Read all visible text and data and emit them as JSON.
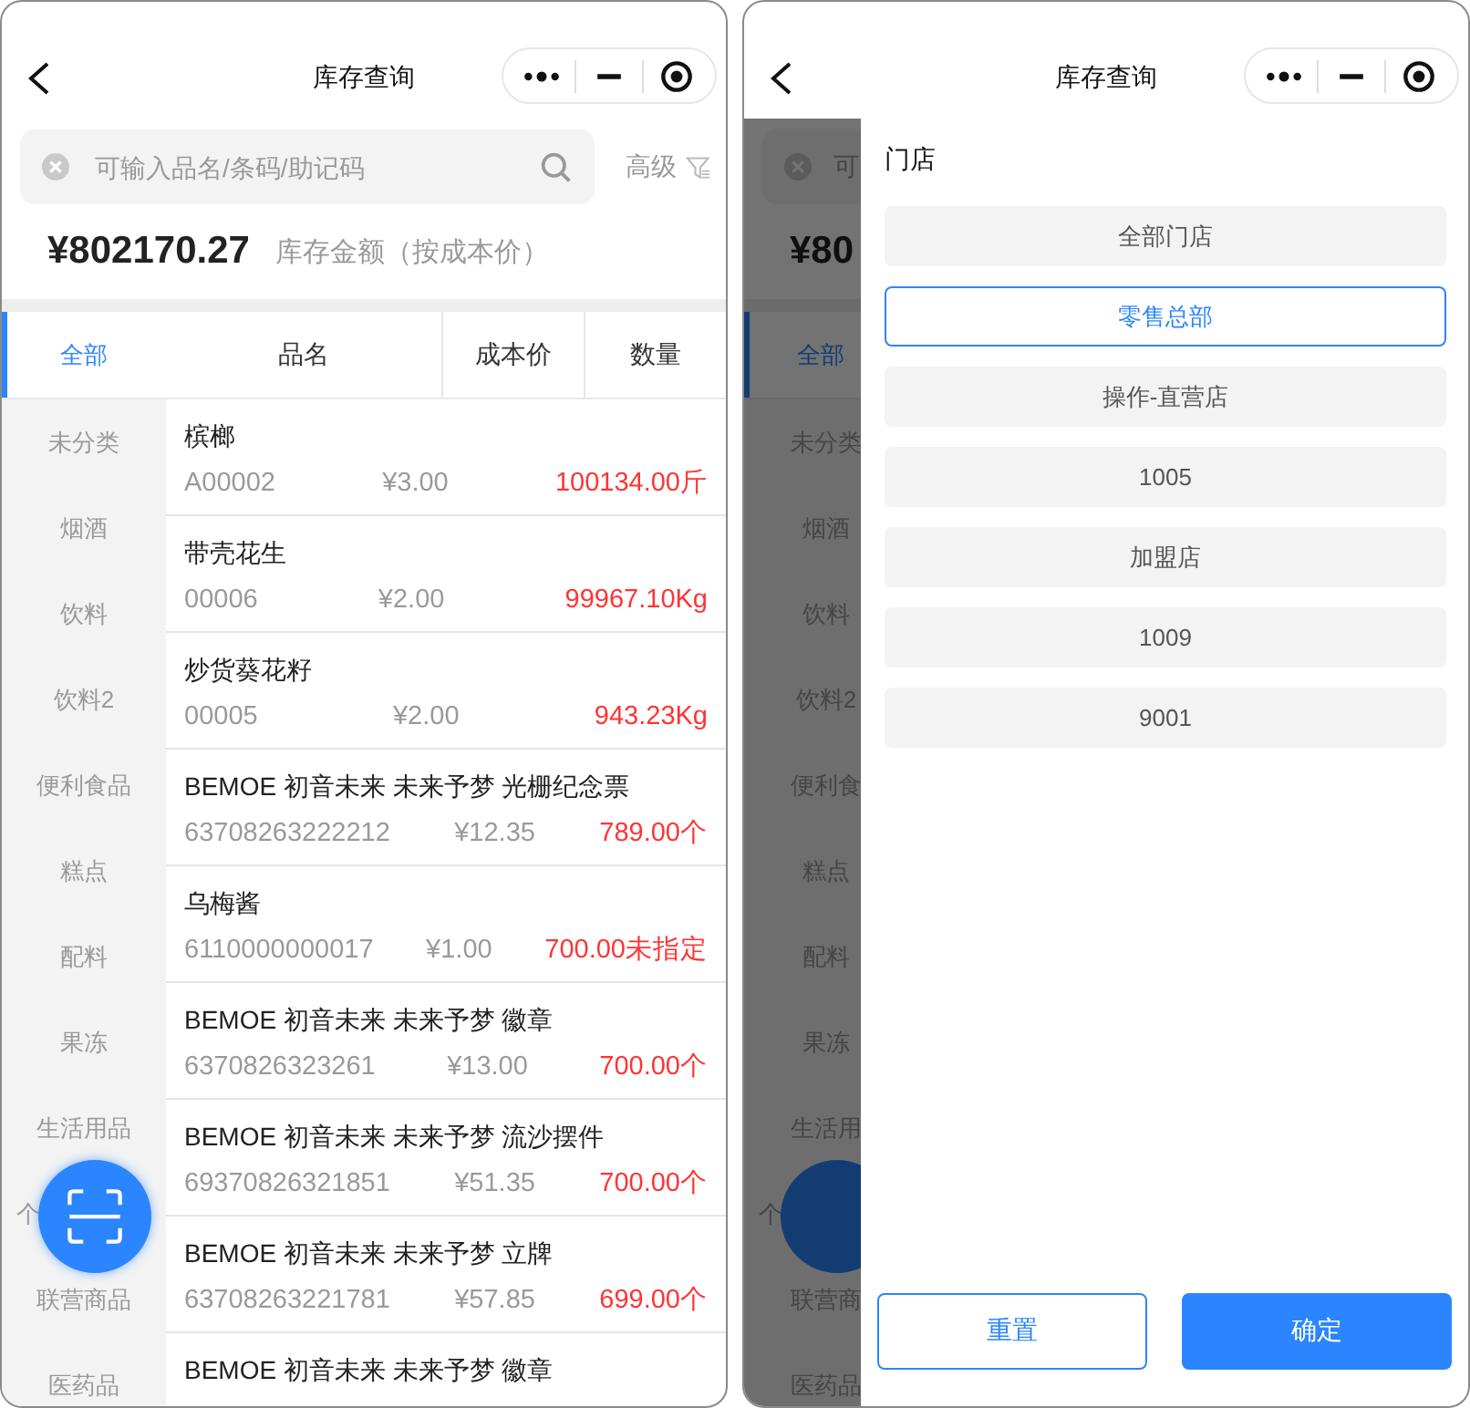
{
  "left_screen": {
    "nav": {
      "title": "库存查询"
    },
    "search": {
      "placeholder": "可输入品名/条码/助记码"
    },
    "advanced": "高级",
    "total": {
      "amount": "¥802170.27",
      "label": "库存金额（按成本价）"
    },
    "category_tab": {
      "label": "全部",
      "selected": true
    },
    "columns": [
      "品名",
      "成本价",
      "数量"
    ],
    "categories": [
      {
        "label": "未分类",
        "kind": "full"
      },
      {
        "label": "烟酒",
        "kind": "full"
      },
      {
        "label": "饮料",
        "kind": "full"
      },
      {
        "label": "饮料2",
        "kind": "full"
      },
      {
        "label": "便利食品",
        "kind": "full"
      },
      {
        "label": "糕点",
        "kind": "full"
      },
      {
        "label": "配料",
        "kind": "full"
      },
      {
        "label": "果冻",
        "kind": "full"
      },
      {
        "label": "生活用品",
        "kind": "full"
      },
      {
        "label": "个",
        "kind": "covered"
      },
      {
        "label": "联营商品",
        "kind": "full"
      },
      {
        "label": "医药品",
        "kind": "full"
      }
    ],
    "rows": [
      {
        "name": "槟榔",
        "code": "A00002",
        "price": "¥3.00",
        "quantity": "100134.00斤"
      },
      {
        "name": "带壳花生",
        "code": "00006",
        "price": "¥2.00",
        "quantity": "99967.10Kg"
      },
      {
        "name": "炒货葵花籽",
        "code": "00005",
        "price": "¥2.00",
        "quantity": "943.23Kg"
      },
      {
        "name": "BEMOE 初音未来 未来予梦 光栅纪念票",
        "code": "63708263222212",
        "price": "¥12.35",
        "quantity": "789.00个"
      },
      {
        "name": "乌梅酱",
        "code": "6110000000017",
        "price": "¥1.00",
        "quantity": "700.00未指定"
      },
      {
        "name": "BEMOE 初音未来 未来予梦 徽章",
        "code": "6370826323261",
        "price": "¥13.00",
        "quantity": "700.00个"
      },
      {
        "name": "BEMOE 初音未来 未来予梦 流沙摆件",
        "code": "69370826321851",
        "price": "¥51.35",
        "quantity": "700.00个"
      },
      {
        "name": "BEMOE 初音未来 未来予梦 立牌",
        "code": "63708263221781",
        "price": "¥57.85",
        "quantity": "699.00个"
      },
      {
        "name": "BEMOE 初音未来 未来予梦 徽章"
      }
    ]
  },
  "right_screen": {
    "nav": {
      "title": "库存查询"
    },
    "background": {
      "search_text": "可",
      "amount": "¥80",
      "category_tab": {
        "label": "全部",
        "selected": true
      },
      "categories": [
        {
          "label": "未分类",
          "kind": "full"
        },
        {
          "label": "烟酒",
          "kind": "full"
        },
        {
          "label": "饮料",
          "kind": "full"
        },
        {
          "label": "饮料2",
          "kind": "full"
        },
        {
          "label": "便利食",
          "kind": "full"
        },
        {
          "label": "糕点",
          "kind": "full"
        },
        {
          "label": "配料",
          "kind": "full"
        },
        {
          "label": "果冻",
          "kind": "full"
        },
        {
          "label": "生活用",
          "kind": "full"
        },
        {
          "label": "个",
          "kind": "covered"
        },
        {
          "label": "联营商",
          "kind": "full"
        },
        {
          "label": "医药品",
          "kind": "full"
        }
      ]
    },
    "drawer": {
      "title": "门店",
      "stores": [
        {
          "label": "全部门店",
          "selected": false
        },
        {
          "label": "零售总部",
          "selected": true
        },
        {
          "label": "操作-直营店",
          "selected": false
        },
        {
          "label": "1005",
          "selected": false
        },
        {
          "label": "加盟店",
          "selected": false
        },
        {
          "label": "1009",
          "selected": false
        },
        {
          "label": "9001",
          "selected": false
        }
      ],
      "reset": "重置",
      "confirm": "确定"
    }
  }
}
